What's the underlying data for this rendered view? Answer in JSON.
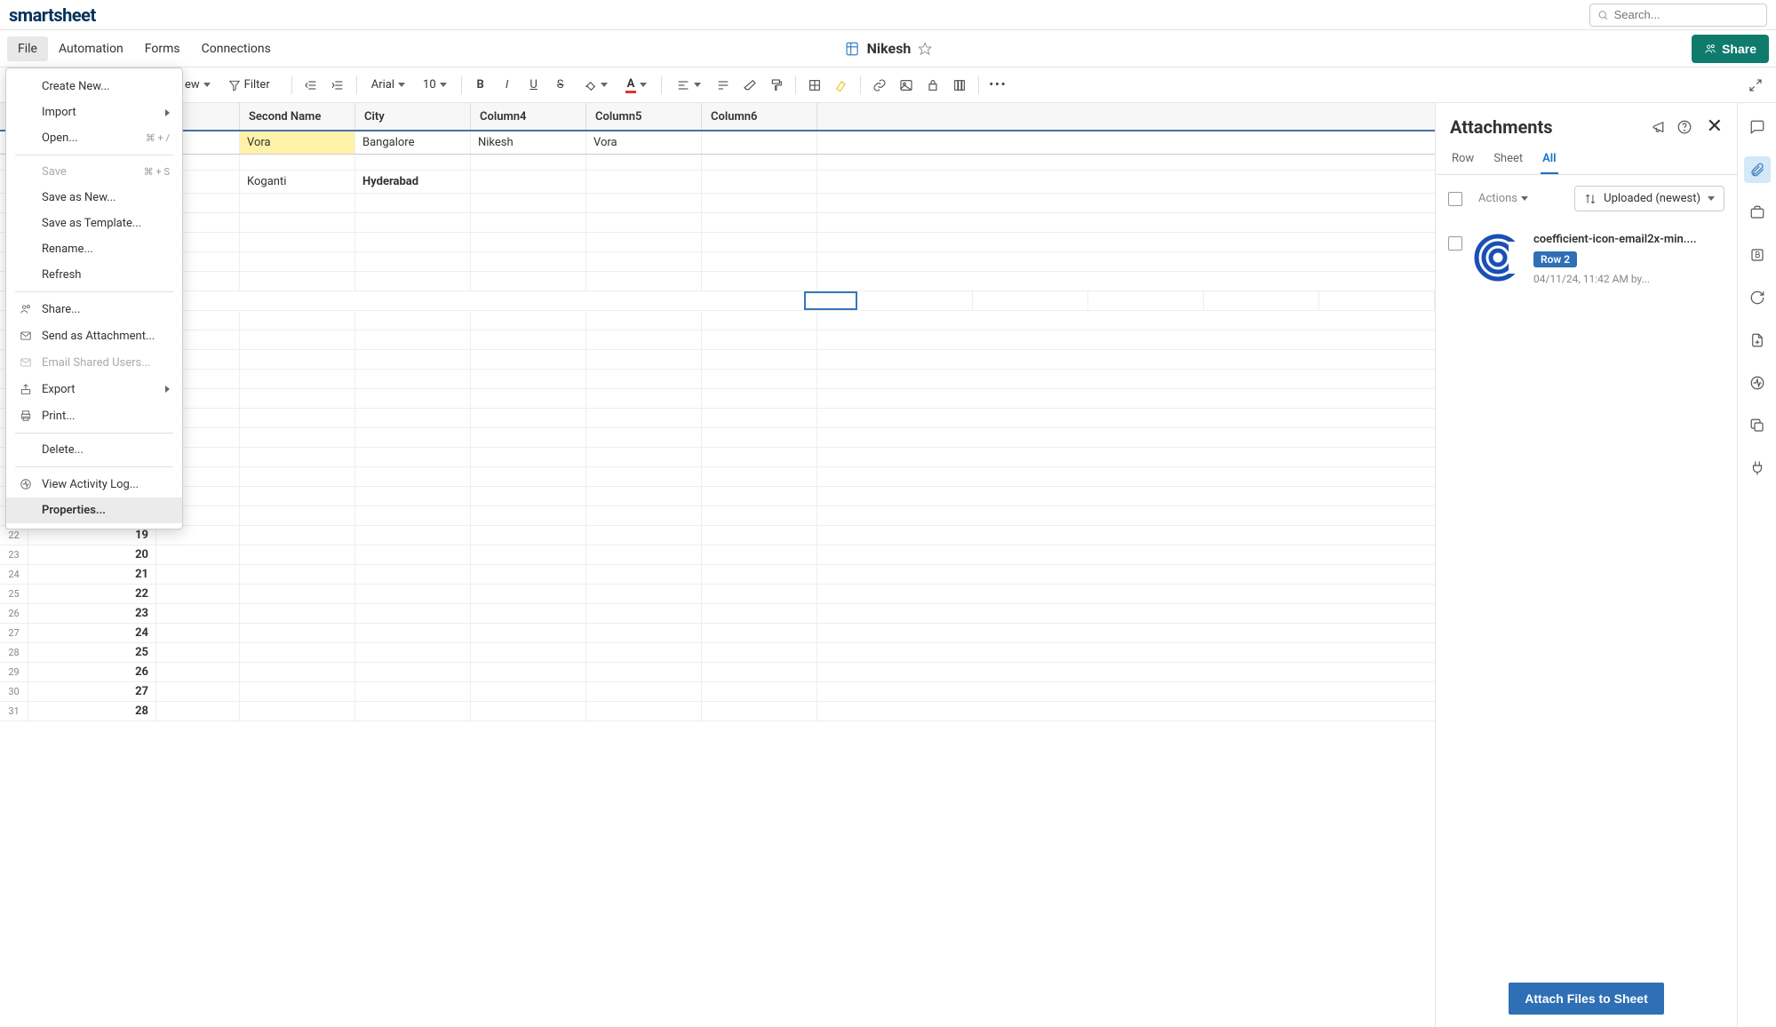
{
  "logo": "smartsheet",
  "search": {
    "placeholder": "Search..."
  },
  "menus": {
    "file": "File",
    "automation": "Automation",
    "forms": "Forms",
    "connections": "Connections"
  },
  "doc": {
    "title": "Nikesh"
  },
  "share_label": "Share",
  "toolbar": {
    "view": "ew",
    "filter": "Filter",
    "font": "Arial",
    "size": "10"
  },
  "columns": [
    "Second Name",
    "City",
    "Column4",
    "Column5",
    "Column6"
  ],
  "rows": [
    {
      "cells": [
        "Vora",
        "Bangalore",
        "Nikesh",
        "Vora",
        ""
      ],
      "highlight_idx": 0
    },
    {
      "spacer": true
    },
    {
      "cells": [
        "Koganti",
        "Hyderabad",
        "",
        "",
        ""
      ],
      "bold_idx": 1
    }
  ],
  "primary_numbers": [
    "19",
    "20",
    "21",
    "22",
    "23",
    "24",
    "25",
    "26",
    "27",
    "28"
  ],
  "row_labels_start": 22,
  "file_menu": {
    "create": "Create New...",
    "import": "Import",
    "open": "Open...",
    "open_shortcut": "⌘ + /",
    "save": "Save",
    "save_shortcut": "⌘ + S",
    "save_as": "Save as New...",
    "save_tpl": "Save as Template...",
    "rename": "Rename...",
    "refresh": "Refresh",
    "share": "Share...",
    "send_att": "Send as Attachment...",
    "email_shared": "Email Shared Users...",
    "export": "Export",
    "print": "Print...",
    "delete": "Delete...",
    "activity": "View Activity Log...",
    "properties": "Properties..."
  },
  "attachments": {
    "title": "Attachments",
    "tabs": {
      "row": "Row",
      "sheet": "Sheet",
      "all": "All"
    },
    "actions": "Actions",
    "sort": "Uploaded (newest)",
    "item": {
      "filename": "coefficient-icon-email2x-min....",
      "row_badge": "Row 2",
      "meta": "04/11/24, 11:42 AM by..."
    },
    "attach_btn": "Attach Files to Sheet"
  }
}
